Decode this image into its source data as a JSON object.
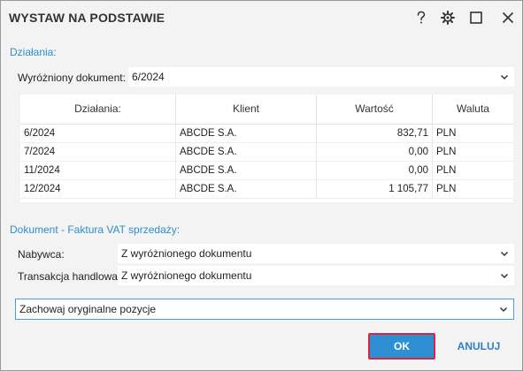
{
  "dialog": {
    "title": "WYSTAW NA PODSTAWIE",
    "help_icon": "question-icon",
    "settings_icon": "gear-icon",
    "maximize_icon": "maximize-icon",
    "close_icon": "close-icon"
  },
  "actions_section": {
    "label": "Działania:",
    "highlighted_label": "Wyróżniony dokument:",
    "highlighted_value": "6/2024"
  },
  "grid": {
    "columns": [
      "Działania:",
      "Klient",
      "Wartość",
      "Waluta"
    ],
    "rows": [
      {
        "doc": "6/2024",
        "client": "ABCDE S.A.",
        "value": "832,71",
        "currency": "PLN"
      },
      {
        "doc": "7/2024",
        "client": "ABCDE S.A.",
        "value": "0,00",
        "currency": "PLN"
      },
      {
        "doc": "11/2024",
        "client": "ABCDE S.A.",
        "value": "0,00",
        "currency": "PLN"
      },
      {
        "doc": "12/2024",
        "client": "ABCDE S.A.",
        "value": "1 105,77",
        "currency": "PLN"
      }
    ]
  },
  "document_section": {
    "label": "Dokument - Faktura VAT sprzedaży:",
    "buyer_label": "Nabywca:",
    "buyer_value": "Z wyróżnionego dokumentu",
    "transaction_label": "Transakcja handlowa:",
    "transaction_value": "Z wyróżnionego dokumentu",
    "positions_value": "Zachowaj oryginalne pozycje"
  },
  "buttons": {
    "ok": "OK",
    "cancel": "ANULUJ"
  },
  "colors": {
    "accent": "#2f8fd3",
    "section_label": "#2f8fc8",
    "ok_outline": "#d7263d"
  }
}
